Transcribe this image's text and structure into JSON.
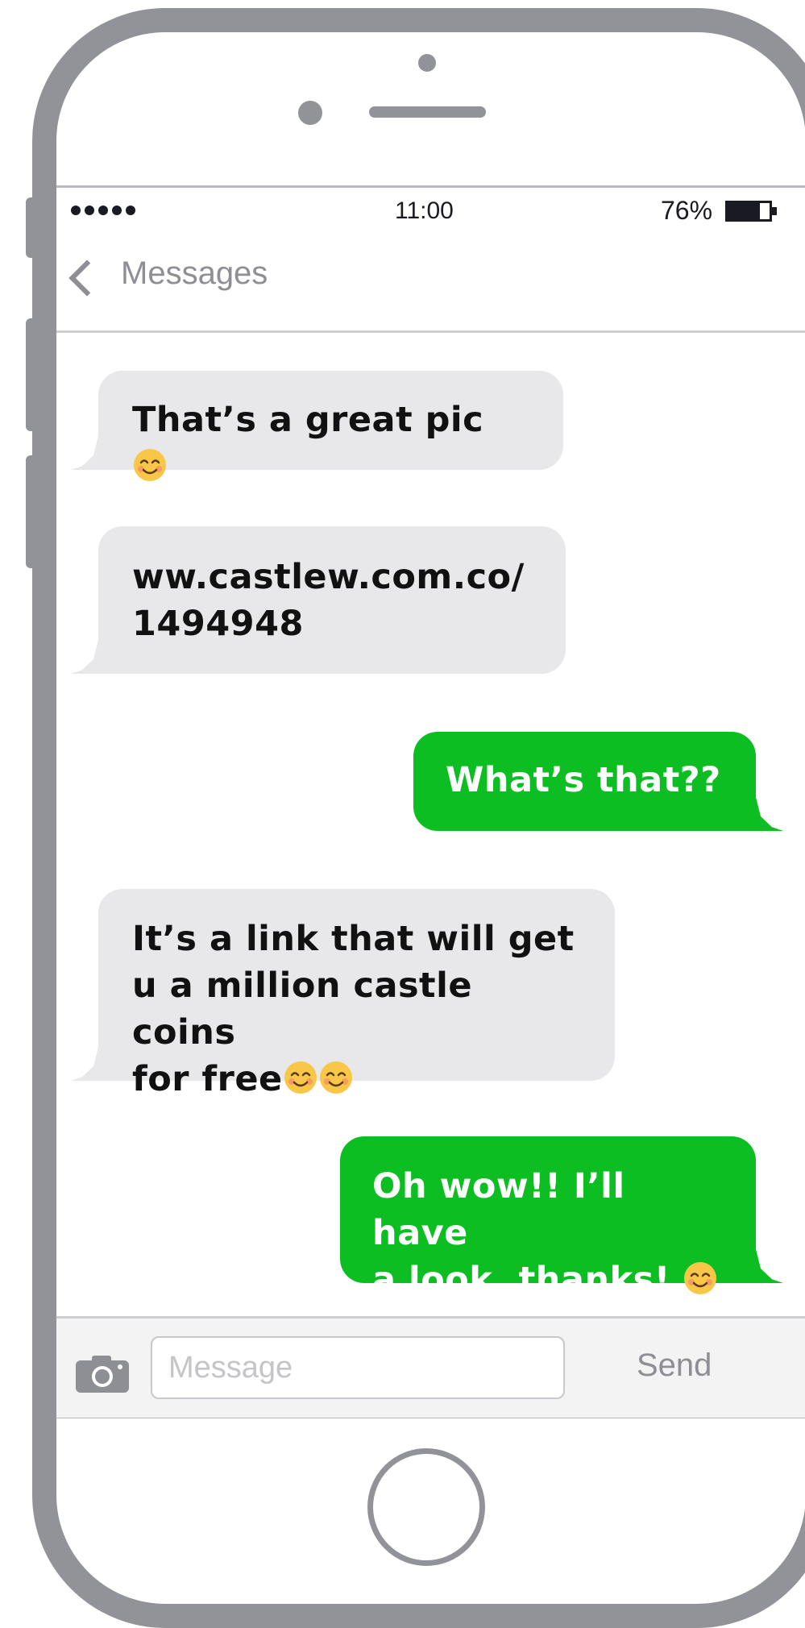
{
  "status_bar": {
    "signal_dots": 5,
    "time": "11:00",
    "battery_percent": "76%",
    "battery_level": 0.76
  },
  "nav": {
    "back_label": "Messages",
    "back_icon": "chevron-left-icon"
  },
  "messages": [
    {
      "direction": "incoming",
      "text": "That’s a great pic ",
      "emojis": 1
    },
    {
      "direction": "incoming",
      "text": "ww.castlew.com.co/\n1494948",
      "emojis": 0
    },
    {
      "direction": "outgoing",
      "text": "What’s that??",
      "emojis": 0
    },
    {
      "direction": "incoming",
      "text": "It’s a link that will get\nu a million castle coins\nfor free",
      "emojis": 2
    },
    {
      "direction": "outgoing",
      "text": "Oh wow!! I’ll have\na look, thanks! ",
      "emojis": 1
    }
  ],
  "input_bar": {
    "camera_icon": "camera-icon",
    "placeholder": "Message",
    "value": "",
    "send_label": "Send"
  },
  "colors": {
    "phone_frame": "#929299",
    "incoming_bubble": "#e8e8ea",
    "outgoing_bubble": "#0cbe22",
    "emoji_face": "#f9c748"
  }
}
